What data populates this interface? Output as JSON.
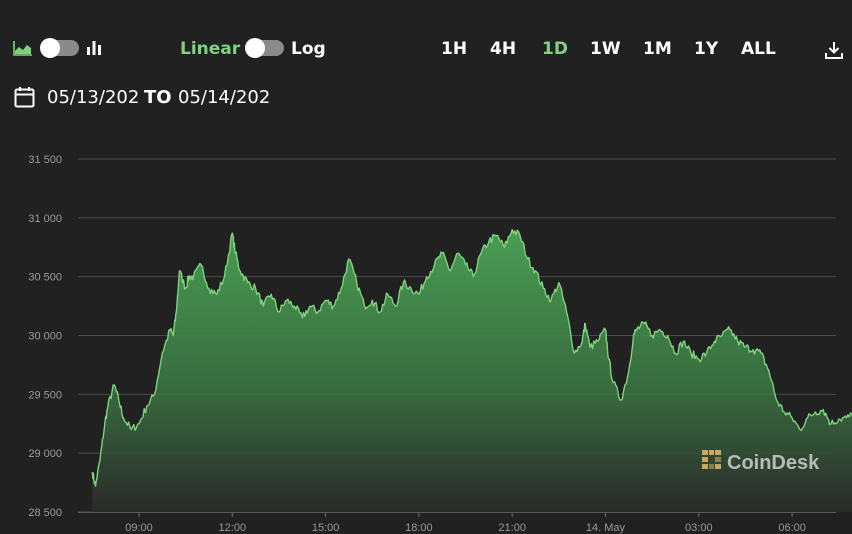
{
  "toolbar": {
    "scale_linear_label": "Linear",
    "scale_log_label": "Log",
    "ranges": [
      "1H",
      "4H",
      "1D",
      "1W",
      "1M",
      "1Y",
      "ALL"
    ],
    "active_range": "1D",
    "accent_color": "#7fd27f"
  },
  "date_range": {
    "from": "05/13/202",
    "connector": "TO",
    "to": "05/14/202"
  },
  "watermark": "CoinDesk",
  "chart_data": {
    "type": "area",
    "title": "",
    "xlabel": "",
    "ylabel": "",
    "ylim": [
      28500,
      31500
    ],
    "yticks": [
      28500,
      29000,
      29500,
      30000,
      30500,
      31000,
      31500
    ],
    "ytick_labels": [
      "28 500",
      "29 000",
      "29 500",
      "30 000",
      "30 500",
      "31 000",
      "31 500"
    ],
    "xticks": [
      "09:00",
      "12:00",
      "15:00",
      "18:00",
      "21:00",
      "14. May",
      "03:00",
      "06:00"
    ],
    "grid": "horizontal",
    "series": [
      {
        "color": "#7fd27f",
        "x": [
          7.5,
          7.6,
          7.75,
          7.9,
          8.0,
          8.2,
          8.35,
          8.5,
          8.75,
          9.0,
          9.25,
          9.5,
          9.75,
          10.0,
          10.1,
          10.2,
          10.3,
          10.5,
          10.6,
          10.75,
          11.0,
          11.25,
          11.5,
          11.75,
          12.0,
          12.1,
          12.25,
          12.5,
          12.75,
          13.0,
          13.25,
          13.5,
          13.75,
          14.0,
          14.25,
          14.5,
          14.75,
          15.0,
          15.25,
          15.5,
          15.75,
          16.0,
          16.25,
          16.5,
          16.75,
          17.0,
          17.25,
          17.5,
          17.75,
          18.0,
          18.25,
          18.5,
          18.75,
          19.0,
          19.25,
          19.5,
          19.75,
          20.0,
          20.25,
          20.5,
          20.75,
          21.0,
          21.25,
          21.5,
          21.75,
          22.0,
          22.25,
          22.5,
          22.75,
          23.0,
          23.25,
          23.35,
          23.5,
          23.75,
          24.0,
          24.1,
          24.25,
          24.5,
          24.75,
          24.9,
          25.0,
          25.25,
          25.5,
          25.75,
          26.0,
          26.25,
          26.5,
          26.75,
          27.0,
          27.25,
          27.5,
          27.75,
          28.0,
          28.25,
          28.5,
          28.75,
          29.0,
          29.25,
          29.5,
          29.75,
          30.0,
          30.25,
          30.5,
          30.75,
          31.0,
          31.25,
          31.5,
          31.75,
          32.0,
          32.25,
          32.4
        ],
        "values": [
          28840,
          28720,
          28950,
          29250,
          29400,
          29580,
          29450,
          29300,
          29200,
          29250,
          29400,
          29500,
          29850,
          30050,
          30000,
          30200,
          30550,
          30400,
          30500,
          30500,
          30600,
          30400,
          30350,
          30500,
          30870,
          30700,
          30550,
          30450,
          30400,
          30250,
          30350,
          30200,
          30300,
          30250,
          30150,
          30250,
          30200,
          30300,
          30250,
          30400,
          30650,
          30450,
          30250,
          30300,
          30200,
          30350,
          30250,
          30450,
          30400,
          30350,
          30500,
          30600,
          30700,
          30550,
          30700,
          30600,
          30500,
          30700,
          30800,
          30850,
          30750,
          30900,
          30850,
          30650,
          30550,
          30400,
          30300,
          30450,
          30200,
          29850,
          29950,
          30100,
          29900,
          29950,
          30050,
          29800,
          29600,
          29450,
          29700,
          30000,
          30050,
          30100,
          30000,
          30050,
          30000,
          29850,
          29950,
          29850,
          29800,
          29850,
          29950,
          30000,
          30050,
          29950,
          29900,
          29880,
          29850,
          29700,
          29450,
          29350,
          29300,
          29200,
          29300,
          29350,
          29370,
          29250,
          29290,
          29300,
          29330,
          29300,
          29330
        ]
      }
    ]
  }
}
